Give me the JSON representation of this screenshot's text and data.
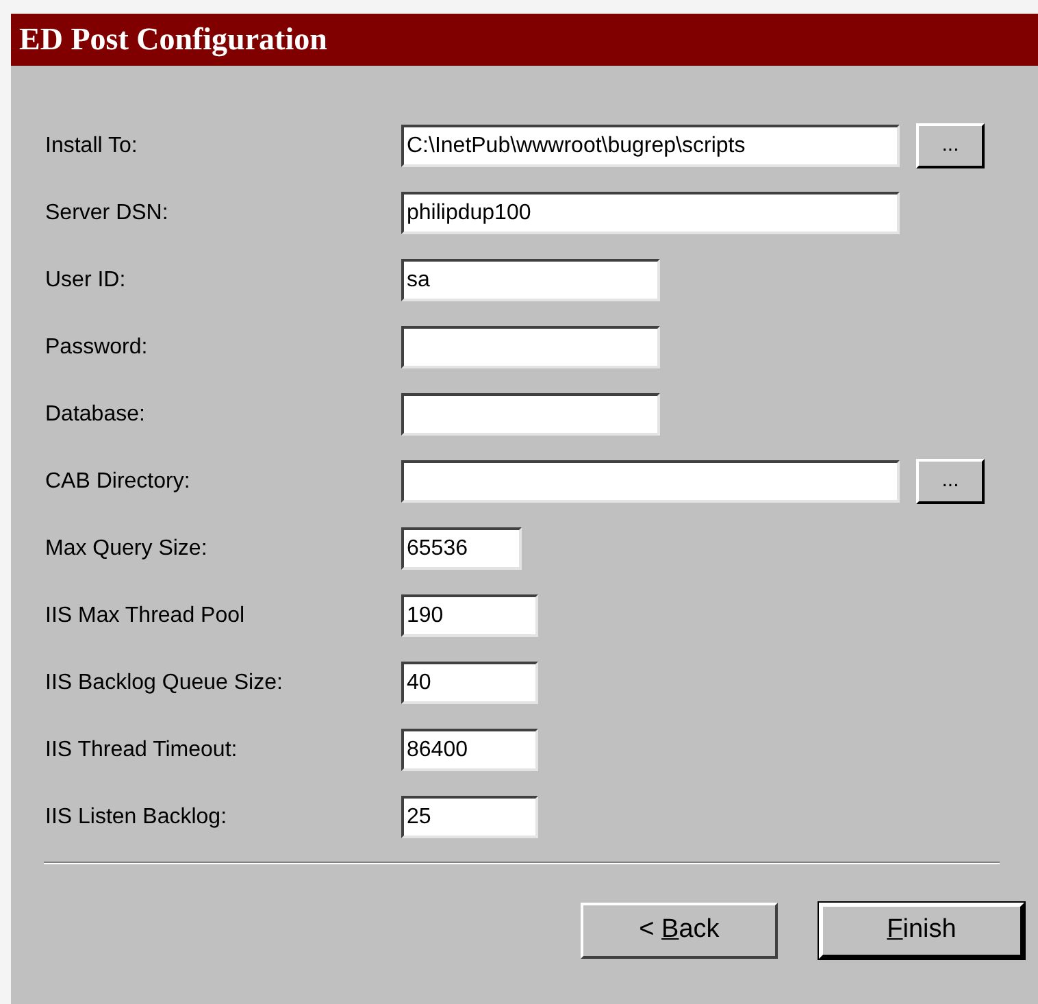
{
  "window": {
    "title": "ED Post Configuration"
  },
  "fields": [
    {
      "label": "Install To:",
      "value": "C:\\InetPub\\wwwroot\\bugrep\\scripts",
      "browse": "..."
    },
    {
      "label": "Server DSN:",
      "value": "philipdup100"
    },
    {
      "label": "User ID:",
      "value": "sa"
    },
    {
      "label": "Password:"
    },
    {
      "label": "Database:"
    },
    {
      "label": "CAB Directory:",
      "browse": "..."
    },
    {
      "label": "Max Query Size:",
      "value": "65536"
    },
    {
      "label": "IIS Max Thread Pool",
      "value": "190"
    },
    {
      "label": "IIS Backlog Queue Size:",
      "value": "40"
    },
    {
      "label": "IIS Thread Timeout:",
      "value": "86400"
    },
    {
      "label": "IIS Listen Backlog:",
      "value": "25"
    }
  ],
  "buttons": [
    {
      "label": "< Back",
      "default": false
    },
    {
      "label": "Finish",
      "default": true
    }
  ]
}
